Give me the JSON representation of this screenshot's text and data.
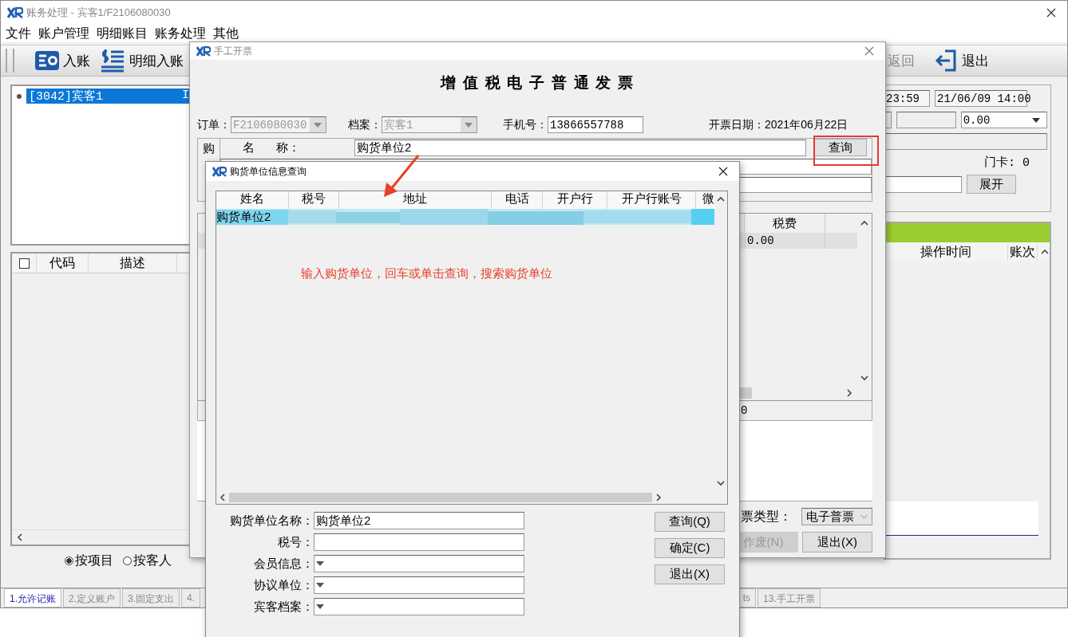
{
  "main_window": {
    "title": "账务处理 - 宾客1/F2106080030",
    "menu": [
      "文件",
      "账户管理",
      "明细账目",
      "账务处理",
      "其他"
    ],
    "toolbar_left": [
      {
        "kind": "post",
        "label": "入账"
      },
      {
        "kind": "detail",
        "label": "明细入账"
      }
    ],
    "toolbar_right": [
      {
        "kind": "back",
        "label": "返回",
        "disabled": true
      },
      {
        "kind": "exit",
        "label": "退出",
        "disabled": false
      }
    ],
    "guest_list": [
      {
        "name": "[3042]宾客1",
        "flag": "I",
        "selected": true
      }
    ],
    "item_table": {
      "select_all_checked": false,
      "columns": [
        "代码",
        "描述"
      ]
    },
    "group_by": [
      {
        "label": "按项目",
        "selected": true
      },
      {
        "label": "按客人",
        "selected": false
      }
    ],
    "right_panel": {
      "time_to": "23:59",
      "time_from": "21/06/09 14:00",
      "amount": "0.00",
      "door_card": "门卡: 0",
      "expand_button": "展开"
    },
    "log_table": {
      "columns": [
        "操作时间",
        "账次"
      ]
    },
    "tabs": [
      {
        "label": "1.允许记账",
        "selected": true
      },
      {
        "label": "2.定义账户",
        "selected": false
      },
      {
        "label": "3.固定支出",
        "selected": false
      },
      {
        "label": "4.",
        "selected": false
      },
      {
        "label": "ts",
        "selected": false
      },
      {
        "label": "13.手工开票",
        "selected": false
      }
    ]
  },
  "invoice_window": {
    "title": "手工开票",
    "heading": "增 值 税 电 子 普 通 发 票",
    "order": {
      "label": "订单：",
      "value": "F2106080030",
      "disabled": true
    },
    "archive": {
      "label": "档案：",
      "value": "宾客1",
      "disabled": true
    },
    "phone": {
      "label": "手机号：",
      "value": "13866557788"
    },
    "date": "开票日期：2021年06月22日",
    "buyer": {
      "side_label": "购",
      "name_label": [
        "名",
        "称："
      ],
      "name_value": "购货单位2",
      "query_button": "查询",
      "highlighted": true
    },
    "tax_column": "税费",
    "tax_value": "0.00",
    "total_fragment": "0",
    "invoice_type": {
      "label": "票类型：",
      "value": "电子普票"
    },
    "buttons": [
      {
        "label": "作废(N)",
        "disabled": true
      },
      {
        "label": "退出(X)",
        "disabled": false
      }
    ]
  },
  "query_dialog": {
    "title": "购货单位信息查询",
    "columns": [
      "姓名",
      "税号",
      "地址",
      "电话",
      "开户行",
      "开户行账号",
      "微"
    ],
    "rows": [
      {
        "name": "购货单位2",
        "selected": true
      }
    ],
    "hint": "输入购货单位，回车或单击查询，搜索购货单位",
    "form": [
      {
        "label": "购货单位名称：",
        "kind": "text",
        "value": "购货单位2"
      },
      {
        "label": "税号：",
        "kind": "text"
      },
      {
        "label": "会员信息：",
        "kind": "dropdown"
      },
      {
        "label": "协议单位：",
        "kind": "dropdown"
      },
      {
        "label": "宾客档案：",
        "kind": "dropdown"
      }
    ],
    "buttons": [
      "查询(Q)",
      "确定(C)",
      "退出(X)"
    ]
  }
}
